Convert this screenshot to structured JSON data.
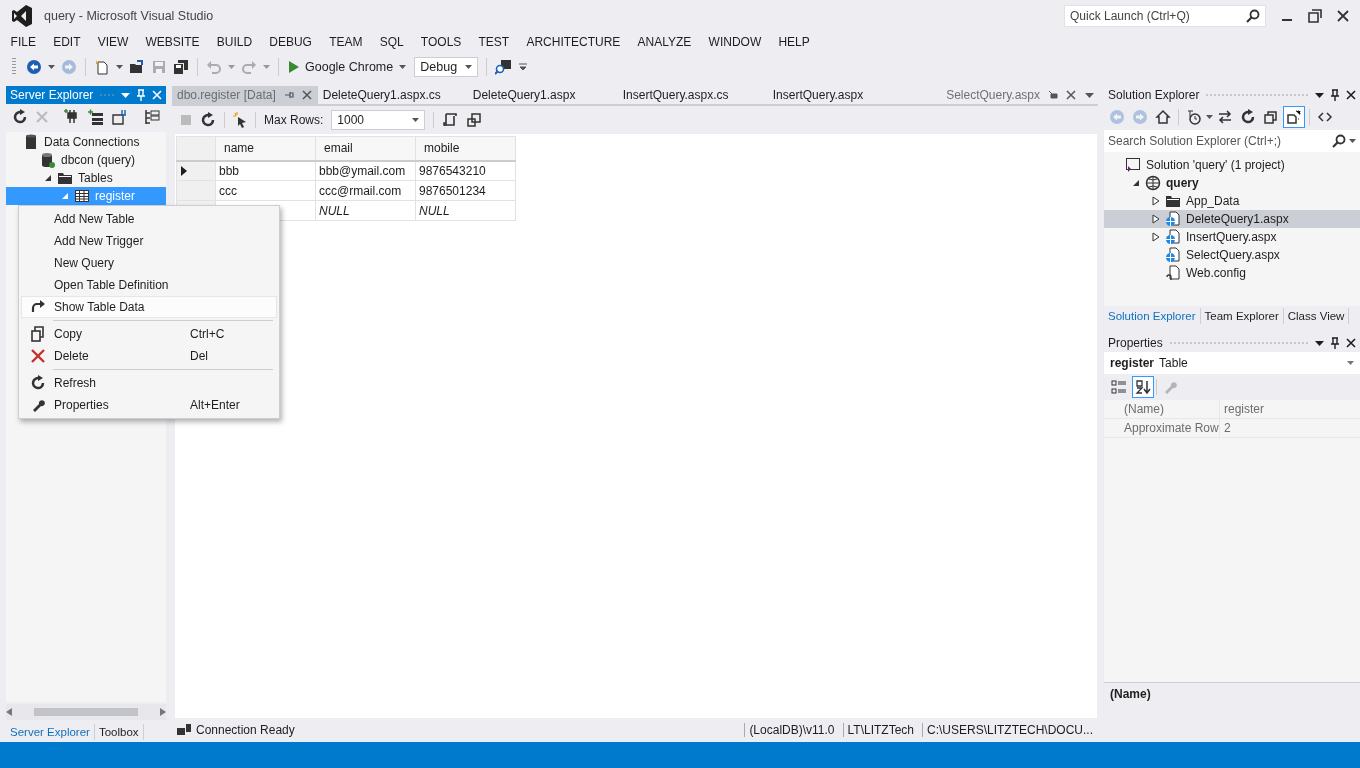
{
  "window": {
    "title": "query - Microsoft Visual Studio"
  },
  "quick_launch": {
    "placeholder": "Quick Launch (Ctrl+Q)"
  },
  "menu": [
    "FILE",
    "EDIT",
    "VIEW",
    "WEBSITE",
    "BUILD",
    "DEBUG",
    "TEAM",
    "SQL",
    "TOOLS",
    "TEST",
    "ARCHITECTURE",
    "ANALYZE",
    "WINDOW",
    "HELP"
  ],
  "toolbar": {
    "buttons": [
      {
        "kind": "back",
        "disabled": false
      },
      {
        "kind": "forward",
        "disabled": true
      },
      {
        "kind": "new",
        "disabled": false
      },
      {
        "kind": "open",
        "disabled": false
      },
      {
        "kind": "save",
        "disabled": true
      },
      {
        "kind": "save-all",
        "disabled": false
      },
      {
        "kind": "undo",
        "disabled": true
      },
      {
        "kind": "redo",
        "disabled": true
      }
    ],
    "start": "Google Chrome",
    "configuration": "Debug"
  },
  "server_explorer": {
    "title": "Server Explorer",
    "tree": [
      {
        "label": "Data Connections",
        "kind": "connections",
        "selected": false,
        "children": [
          {
            "label": "dbcon (query)",
            "kind": "database",
            "selected": false,
            "children": [
              {
                "label": "Tables",
                "kind": "folder",
                "expanded": true,
                "selected": false,
                "children": [
                  {
                    "label": "register",
                    "kind": "table",
                    "expanded": true,
                    "selected": true
                  }
                ]
              }
            ]
          }
        ]
      }
    ],
    "tabs": [
      {
        "label": "Server Explorer",
        "selected": true
      },
      {
        "label": "Toolbox",
        "selected": false
      }
    ]
  },
  "context_menu": {
    "groups": [
      [
        {
          "label": "Add New Table",
          "selected": false
        },
        {
          "label": "Add New Trigger",
          "selected": false
        },
        {
          "label": "New Query",
          "selected": false
        },
        {
          "label": "Open Table Definition",
          "selected": false
        },
        {
          "label": "Show Table Data",
          "selected": true
        }
      ],
      [
        {
          "label": "Copy",
          "shortcut": "Ctrl+C",
          "selected": false
        },
        {
          "label": "Delete",
          "shortcut": "Del",
          "selected": false
        }
      ],
      [
        {
          "label": "Refresh",
          "selected": false
        },
        {
          "label": "Properties",
          "shortcut": "Alt+Enter",
          "selected": false
        }
      ]
    ]
  },
  "documents": {
    "tabs": [
      {
        "label": "dbo.register [Data]",
        "kind": "document",
        "selected": true
      },
      {
        "label": "DeleteQuery1.aspx.cs",
        "kind": "document",
        "selected": false
      },
      {
        "label": "DeleteQuery1.aspx",
        "kind": "document",
        "selected": false
      },
      {
        "label": "InsertQuery.aspx.cs",
        "kind": "document",
        "selected": false
      },
      {
        "label": "InsertQuery.aspx",
        "kind": "document",
        "selected": false
      },
      {
        "label": "SelectQuery.aspx",
        "kind": "preview",
        "selected": false
      }
    ],
    "max_rows_label": "Max Rows:",
    "max_rows": "1000",
    "grid": {
      "columns": [
        "name",
        "email",
        "mobile"
      ],
      "rows": [
        {
          "current": true,
          "cells": [
            {
              "kind": "value",
              "text": "bbb"
            },
            {
              "kind": "value",
              "text": "bbb@ymail.com"
            },
            {
              "kind": "value",
              "text": "9876543210"
            }
          ]
        },
        {
          "current": false,
          "cells": [
            {
              "kind": "value",
              "text": "ccc"
            },
            {
              "kind": "value",
              "text": "ccc@rmail.com"
            },
            {
              "kind": "value",
              "text": "9876501234"
            }
          ]
        },
        {
          "cells": [
            {
              "kind": "covered"
            },
            {
              "kind": "null",
              "text": "NULL"
            },
            {
              "kind": "null",
              "text": "NULL"
            }
          ]
        }
      ]
    },
    "status": {
      "message": "Connection Ready",
      "fields": [
        "(LocalDB)\\v11.0",
        "LT\\LITZTech",
        "C:\\USERS\\LITZTECH\\DOCU..."
      ]
    }
  },
  "solution_explorer": {
    "title": "Solution Explorer",
    "search_placeholder": "Search Solution Explorer (Ctrl+;)",
    "toolbar": [
      {
        "kind": "back",
        "selected": false,
        "disabled": true
      },
      {
        "kind": "forward",
        "selected": false,
        "disabled": true
      },
      {
        "kind": "home",
        "selected": false,
        "disabled": false
      },
      {
        "kind": "pending",
        "selected": false,
        "disabled": false
      },
      {
        "kind": "sync",
        "selected": false,
        "disabled": false
      },
      {
        "kind": "refresh",
        "selected": false,
        "disabled": false
      },
      {
        "kind": "collapse",
        "selected": false,
        "disabled": false
      },
      {
        "kind": "show-all",
        "selected": true,
        "disabled": false
      },
      {
        "kind": "code",
        "selected": false,
        "disabled": false
      }
    ],
    "tree": [
      {
        "label": "Solution 'query' (1 project)",
        "kind": "solution",
        "selected": false,
        "children": [
          {
            "label": "query",
            "kind": "website",
            "expanded": true,
            "selected": false,
            "children": [
              {
                "label": "App_Data",
                "kind": "folder",
                "expanded": false,
                "selected": false
              },
              {
                "label": "DeleteQuery1.aspx",
                "kind": "aspx",
                "expanded": false,
                "selected": true
              },
              {
                "label": "InsertQuery.aspx",
                "kind": "aspx",
                "expanded": false,
                "selected": false
              },
              {
                "label": "SelectQuery.aspx",
                "kind": "aspx",
                "selected": false
              },
              {
                "label": "Web.config",
                "kind": "config",
                "selected": false
              }
            ]
          }
        ]
      }
    ],
    "tabs": [
      {
        "label": "Solution Explorer",
        "selected": true
      },
      {
        "label": "Team Explorer",
        "selected": false
      },
      {
        "label": "Class View",
        "selected": false
      }
    ]
  },
  "properties": {
    "title": "Properties",
    "object": "register",
    "type": "Table",
    "toolbar": [
      {
        "kind": "categorized",
        "selected": false,
        "disabled": false
      },
      {
        "kind": "alphabetical",
        "selected": true,
        "disabled": false
      },
      {
        "kind": "pages",
        "selected": false,
        "disabled": true
      }
    ],
    "rows": [
      {
        "name": "(Name)",
        "value": "register"
      },
      {
        "name": "Approximate Row",
        "value": "2"
      }
    ],
    "description": "(Name)"
  }
}
